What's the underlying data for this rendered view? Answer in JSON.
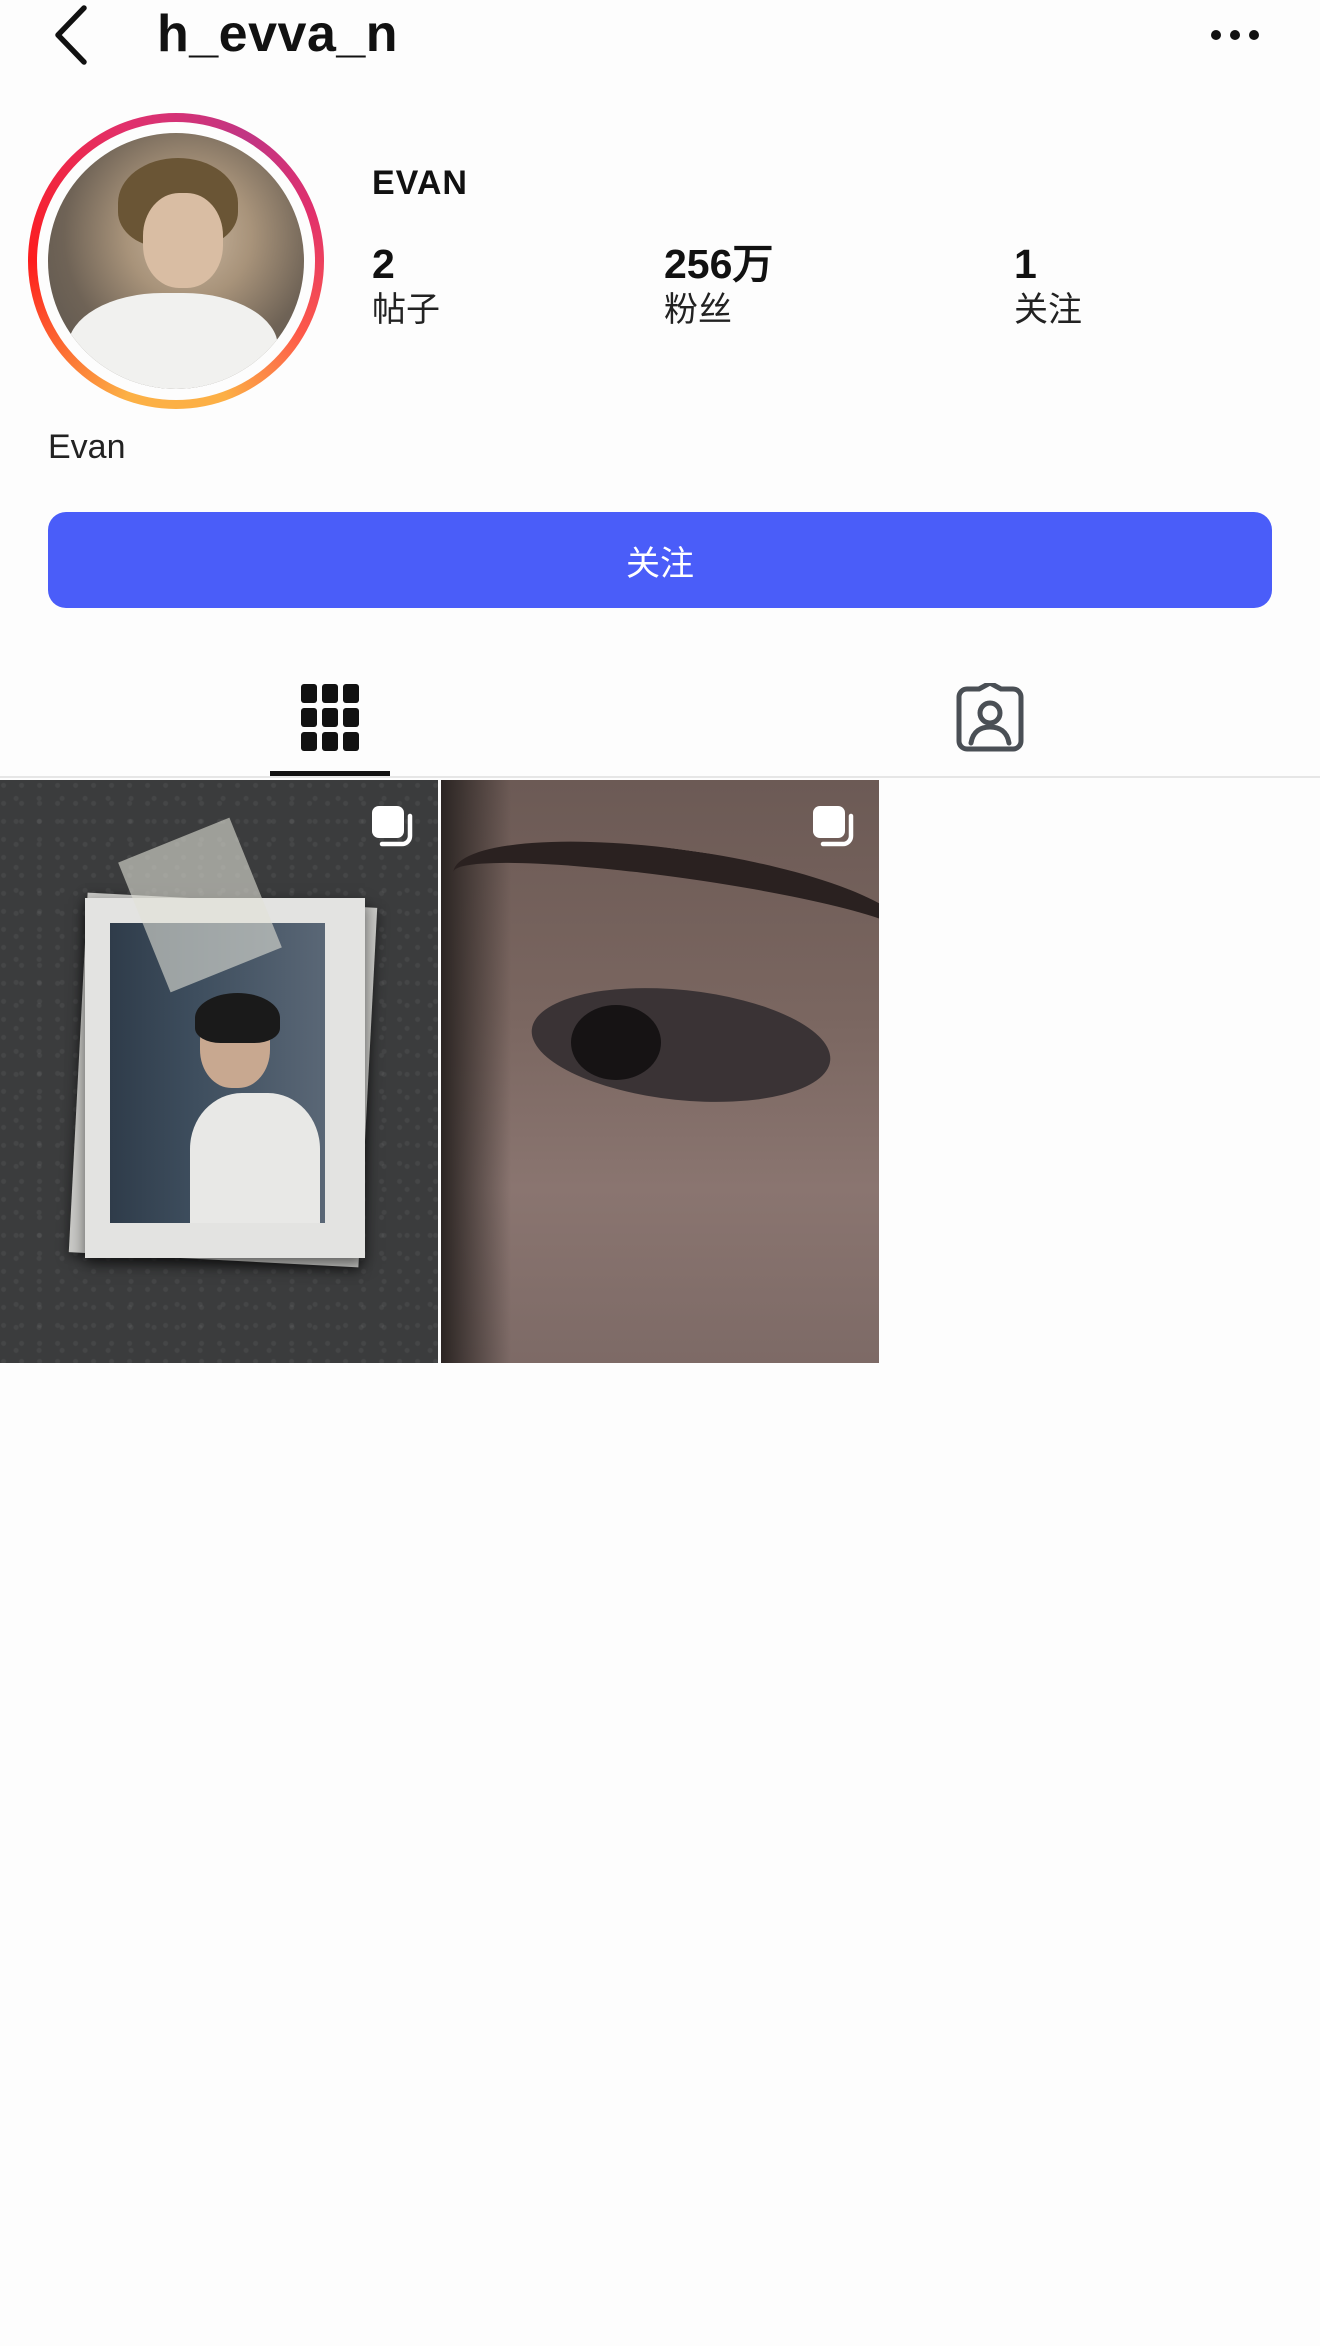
{
  "header": {
    "username": "h_evva_n",
    "back_icon": "chevron-left-icon",
    "more_icon": "more-horizontal-icon"
  },
  "profile": {
    "display_name": "EVAN",
    "stats": [
      {
        "value": "2",
        "label": "帖子"
      },
      {
        "value": "256万",
        "label": "粉丝"
      },
      {
        "value": "1",
        "label": "关注"
      }
    ],
    "bio_name": "Evan"
  },
  "actions": {
    "follow_label": "关注",
    "follow_color": "#4a5df9"
  },
  "tabs": [
    {
      "name": "posts-grid",
      "icon": "grid-icon",
      "active": true
    },
    {
      "name": "tagged",
      "icon": "tagged-person-icon",
      "active": false
    }
  ],
  "posts": [
    {
      "kind": "multi-image",
      "icon": "carousel-icon"
    },
    {
      "kind": "multi-image",
      "icon": "carousel-icon"
    }
  ],
  "colors": {
    "ring_gradient": [
      "#fcb045",
      "#fd1d1d",
      "#e1306c",
      "#c13584"
    ]
  }
}
